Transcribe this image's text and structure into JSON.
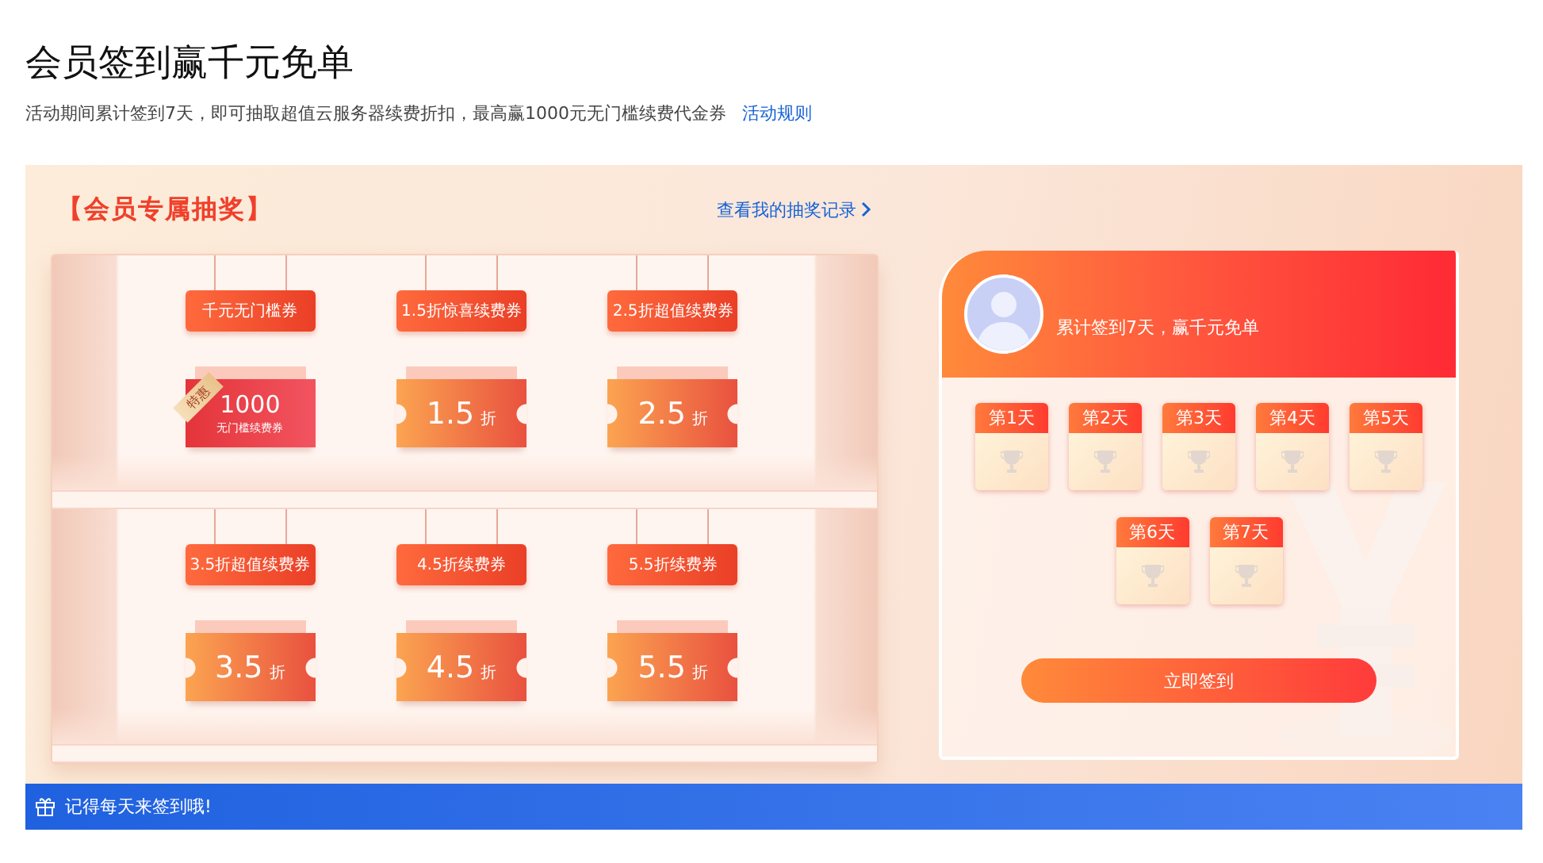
{
  "page": {
    "title": "会员签到赢千元免单",
    "description": "活动期间累计签到7天，即可抽取超值云服务器续费折扣，最高赢1000元无门槛续费代金券",
    "rules_link": "活动规则"
  },
  "lottery": {
    "title": "【会员专属抽奖】",
    "records_link": "查看我的抽奖记录",
    "prizes": [
      {
        "kind": "featured",
        "label": "千元无门槛券",
        "ribbon": "特惠",
        "value": "1000",
        "caption": "无门槛续费券"
      },
      {
        "kind": "discount",
        "label": "1.5折惊喜续费券",
        "value": "1.5",
        "unit": "折"
      },
      {
        "kind": "discount",
        "label": "2.5折超值续费券",
        "value": "2.5",
        "unit": "折"
      },
      {
        "kind": "discount",
        "label": "3.5折超值续费券",
        "value": "3.5",
        "unit": "折"
      },
      {
        "kind": "discount",
        "label": "4.5折续费券",
        "value": "4.5",
        "unit": "折"
      },
      {
        "kind": "discount",
        "label": "5.5折续费券",
        "value": "5.5",
        "unit": "折"
      }
    ]
  },
  "checkin": {
    "message": "累计签到7天，赢千元免单",
    "days": [
      {
        "label": "第1天",
        "checked": false
      },
      {
        "label": "第2天",
        "checked": false
      },
      {
        "label": "第3天",
        "checked": false
      },
      {
        "label": "第4天",
        "checked": false
      },
      {
        "label": "第5天",
        "checked": false
      },
      {
        "label": "第6天",
        "checked": false
      },
      {
        "label": "第7天",
        "checked": false
      }
    ],
    "button": "立即签到"
  },
  "footer": {
    "tip": "记得每天来签到哦!"
  }
}
